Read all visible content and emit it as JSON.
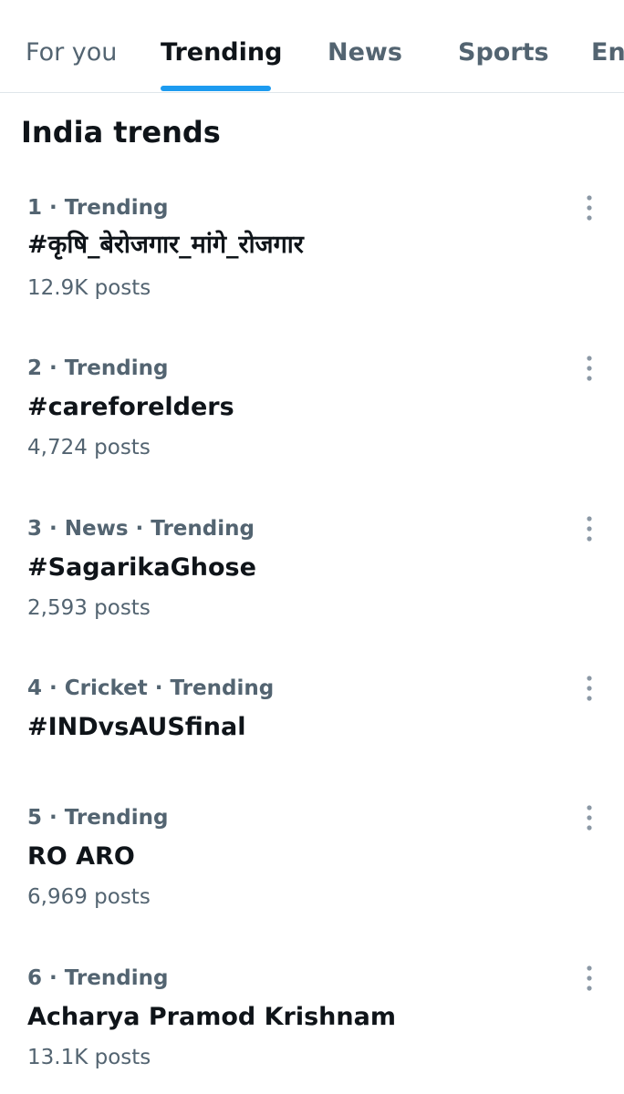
{
  "tabs": [
    {
      "label": "For you",
      "active": false
    },
    {
      "label": "Trending",
      "active": true
    },
    {
      "label": "News",
      "active": false
    },
    {
      "label": "Sports",
      "active": false
    },
    {
      "label": "Ent",
      "active": false
    }
  ],
  "section_title": "India trends",
  "trends": [
    {
      "meta": "1 · Trending",
      "name": "#कृषि_बेरोजगार_मांगे_रोजगार",
      "count": "12.9K posts"
    },
    {
      "meta": "2 · Trending",
      "name": "#careforelders",
      "count": "4,724 posts"
    },
    {
      "meta": "3 · News · Trending",
      "name": "#SagarikaGhose",
      "count": "2,593 posts"
    },
    {
      "meta": "4 · Cricket · Trending",
      "name": "#INDvsAUSfinal",
      "count": ""
    },
    {
      "meta": "5 · Trending",
      "name": "RO ARO",
      "count": "6,969 posts"
    },
    {
      "meta": "6 · Trending",
      "name": "Acharya Pramod Krishnam",
      "count": "13.1K posts"
    }
  ],
  "icons": {
    "more": "more-vertical-icon"
  },
  "colors": {
    "accent": "#1d9bf0",
    "primary_text": "#0f1419",
    "secondary_text": "#536471",
    "divider": "#dfe6ea"
  }
}
